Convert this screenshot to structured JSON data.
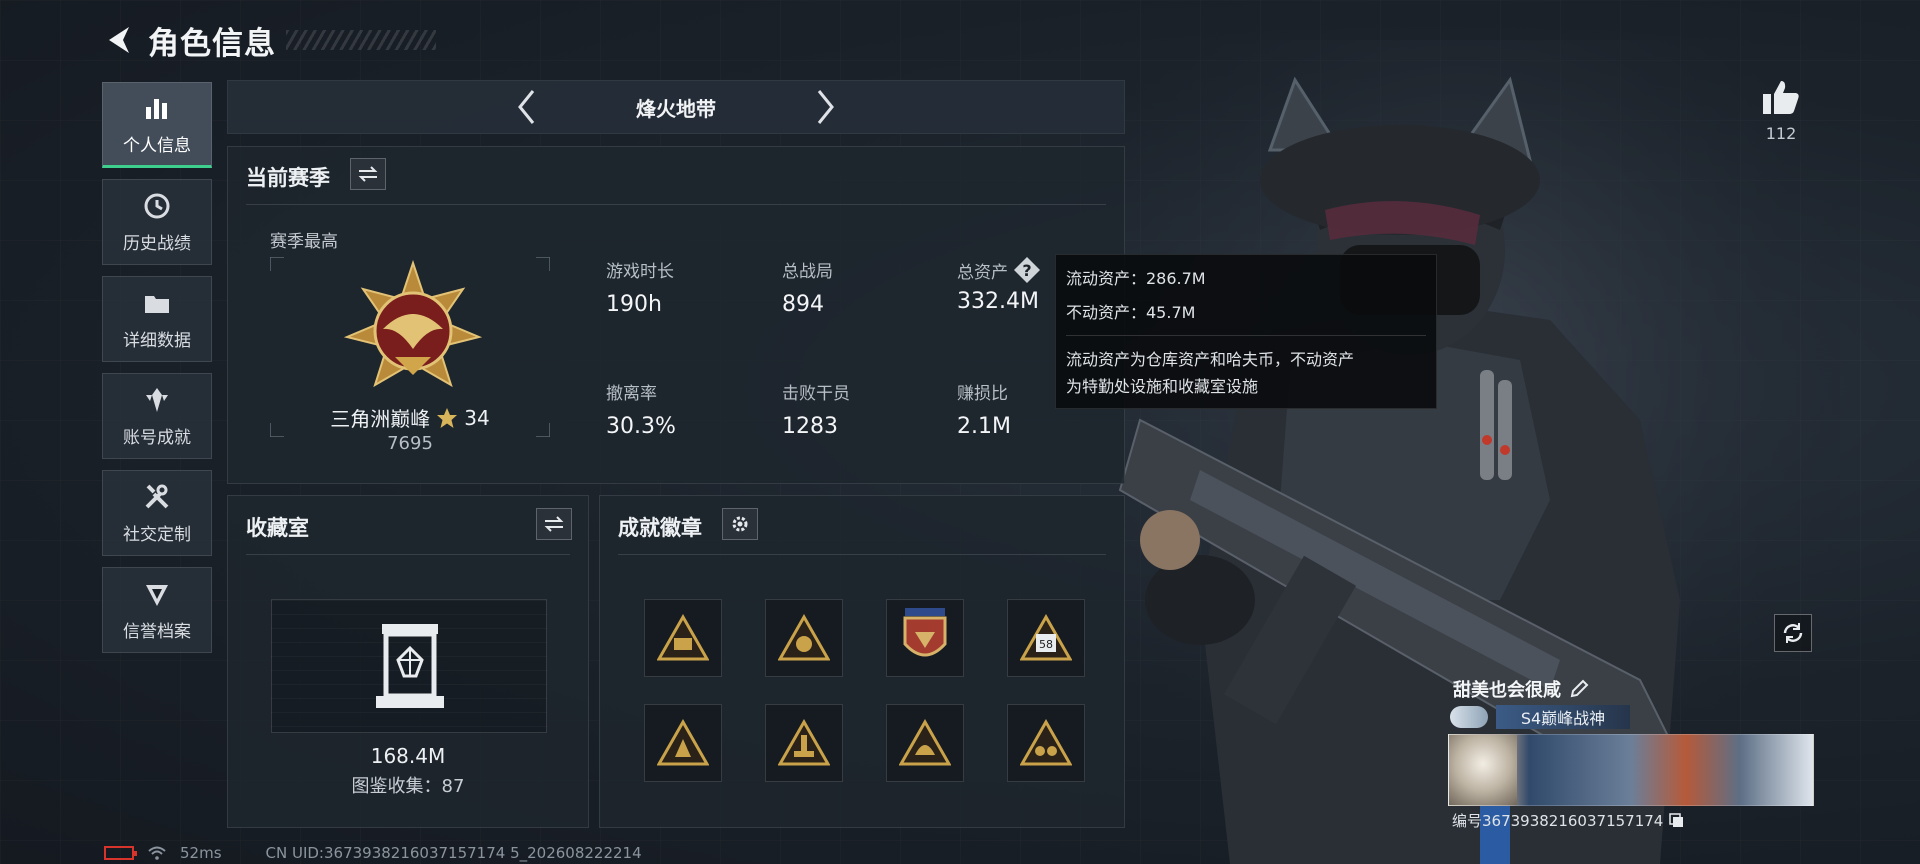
{
  "header": {
    "title": "角色信息"
  },
  "nav": {
    "items": [
      {
        "label": "个人信息",
        "active": true
      },
      {
        "label": "历史战绩",
        "active": false
      },
      {
        "label": "详细数据",
        "active": false
      },
      {
        "label": "账号成就",
        "active": false
      },
      {
        "label": "社交定制",
        "active": false
      },
      {
        "label": "信誉档案",
        "active": false
      }
    ]
  },
  "mode": {
    "name": "烽火地带"
  },
  "season": {
    "title": "当前赛季",
    "best_label": "赛季最高",
    "rank_name": "三角洲巅峰",
    "rank_stars": "34",
    "rank_points": "7695",
    "stats": [
      {
        "label": "游戏时长",
        "value": "190h"
      },
      {
        "label": "总战局",
        "value": "894"
      },
      {
        "label": "总资产",
        "value": "332.4M"
      },
      {
        "label": "撤离率",
        "value": "30.3%"
      },
      {
        "label": "击败干员",
        "value": "1283"
      },
      {
        "label": "赚损比",
        "value": "2.1M"
      }
    ]
  },
  "tooltip": {
    "line1": "流动资产：286.7M",
    "line2": "不动资产：45.7M",
    "desc1": "流动资产为仓库资产和哈夫币，不动资产",
    "desc2": "为特勤处设施和收藏室设施"
  },
  "collection": {
    "title": "收藏室",
    "value": "168.4M",
    "count_text": "图鉴收集：87"
  },
  "badges": {
    "title": "成就徽章",
    "items": [
      "badge-1",
      "badge-2",
      "badge-shield",
      "badge-58",
      "badge-5",
      "badge-6",
      "badge-7",
      "badge-8"
    ],
    "badge_58_text": "58"
  },
  "likes": {
    "count": "112"
  },
  "character": {
    "name": "甜美也会很咸",
    "title": "S4巅峰战神",
    "uid_text": "编号3673938216037157174"
  },
  "status": {
    "ping": "52ms",
    "uid_line": "CN UID:3673938216037157174 5_202608222214"
  },
  "colors": {
    "accent": "#3ecf8e",
    "gold": "#c9a24a",
    "tooltip_bg": "#0a0c0e"
  }
}
